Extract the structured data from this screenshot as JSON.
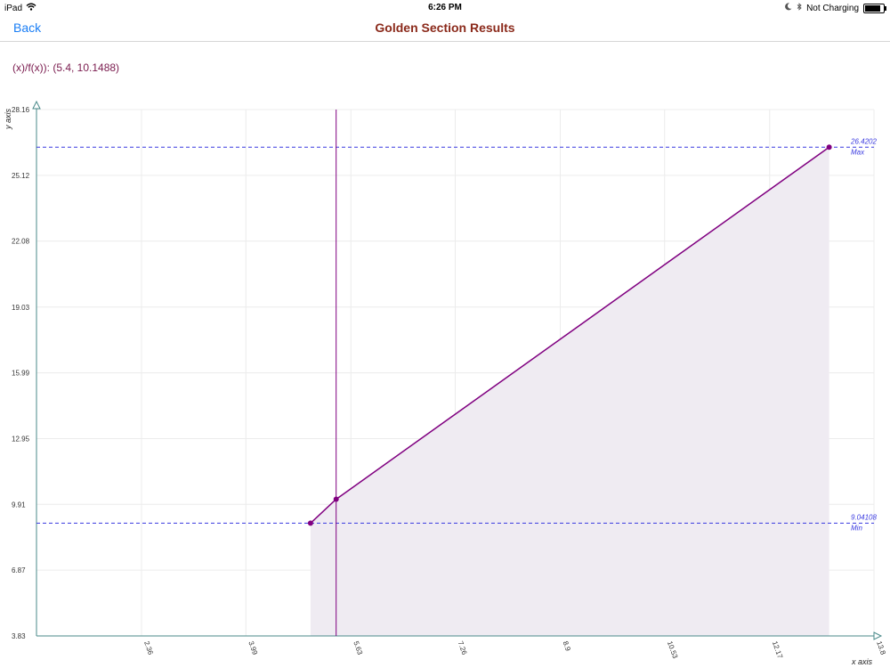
{
  "status": {
    "device": "iPad",
    "time": "6:26 PM",
    "battery_text": "Not Charging",
    "battery_level": 0.95
  },
  "nav": {
    "back_label": "Back",
    "title": "Golden Section Results"
  },
  "readout": "(x)/f(x)): (5.4, 10.1488)",
  "colors": {
    "line": "#800080",
    "reference": "#3a3ae0",
    "fill": "#efebf2",
    "grid": "#ececec",
    "axis": "#4a8a8a",
    "title": "#8b2a1b",
    "back": "#1a7ef5"
  },
  "chart_data": {
    "type": "line",
    "xlabel": "x axis",
    "ylabel": "y axis",
    "xlim": [
      0.72,
      13.8
    ],
    "ylim": [
      3.83,
      28.16
    ],
    "x_ticks": [
      "2.36",
      "3.99",
      "5.63",
      "7.26",
      "8.9",
      "10.53",
      "12.17",
      "13.8"
    ],
    "x_tick_values": [
      2.36,
      3.99,
      5.63,
      7.26,
      8.9,
      10.53,
      12.17,
      13.8
    ],
    "y_ticks": [
      "3.83",
      "6.87",
      "9.91",
      "12.95",
      "15.99",
      "19.03",
      "22.08",
      "25.12",
      "28.16"
    ],
    "y_tick_values": [
      3.83,
      6.87,
      9.91,
      12.95,
      15.99,
      19.03,
      22.08,
      25.12,
      28.16
    ],
    "series": [
      {
        "x": [
          5.0,
          5.4,
          13.1
        ],
        "y": [
          9.04108,
          10.1488,
          26.4202
        ]
      }
    ],
    "vertical_marker_x": 5.4,
    "reference_lines": [
      {
        "value": 26.4202,
        "value_label": "26.4202",
        "label": "Max"
      },
      {
        "value": 9.04108,
        "value_label": "9.04108",
        "label": "Min"
      }
    ],
    "shaded_area": true,
    "grid": true
  }
}
